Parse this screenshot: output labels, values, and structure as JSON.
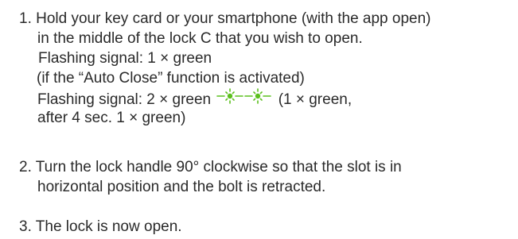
{
  "steps": [
    {
      "lines": [
        "1. Hold your key card or your smartphone (with the app open)",
        "in the middle of the lock C that you wish to open.",
        "Flashing signal: 1 × green",
        "(if the “Auto Close” function is activated)",
        "Flashing signal: 2 × green",
        "(1 × green,",
        "after 4 sec. 1 × green)"
      ]
    },
    {
      "lines": [
        "2. Turn the lock handle 90° clockwise so that the slot is in",
        "horizontal position and the bolt is retracted."
      ]
    },
    {
      "lines": [
        "3. The lock is now open."
      ]
    }
  ],
  "signal_icon": "green-flash-icon",
  "colors": {
    "text": "#2a2a2a",
    "signal_green": "#5cc01e"
  }
}
